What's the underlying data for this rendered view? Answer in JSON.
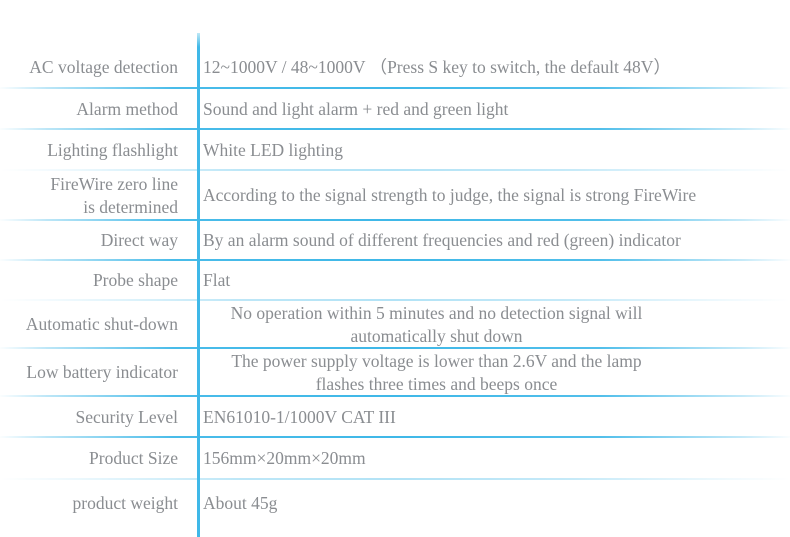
{
  "table": {
    "colors": {
      "rule": "#3fb8e8",
      "text": "#8a8d91",
      "background": "#ffffff"
    },
    "rows": [
      {
        "label": "AC voltage detection",
        "value": "12~1000V / 48~1000V （Press S key to switch, the default 48V）",
        "multiline": false,
        "separator": "strong"
      },
      {
        "label": "Alarm method",
        "value": "Sound and light alarm + red and green light",
        "multiline": false,
        "separator": "strong"
      },
      {
        "label": "Lighting flashlight",
        "value": "White LED lighting",
        "multiline": false,
        "separator": "faint"
      },
      {
        "label": "FireWire zero line\nis determined",
        "value": "According to the signal strength to judge, the signal is strong FireWire",
        "multiline": false,
        "separator": "strong"
      },
      {
        "label": "Direct way",
        "value": "By an alarm sound of different frequencies and red (green) indicator",
        "multiline": false,
        "separator": "strong"
      },
      {
        "label": "Probe shape",
        "value": "Flat",
        "multiline": false,
        "separator": "faint"
      },
      {
        "label": "Automatic shut-down",
        "value": "No operation within 5 minutes and no detection signal will\nautomatically shut down",
        "multiline": true,
        "separator": "strong"
      },
      {
        "label": "Low battery indicator",
        "value": "The power supply voltage is lower than 2.6V and the lamp\nflashes three times and beeps once",
        "multiline": true,
        "separator": "strong"
      },
      {
        "label": "Security Level",
        "value": "EN61010-1/1000V  CAT III",
        "multiline": false,
        "separator": "strong"
      },
      {
        "label": "Product Size",
        "value": "156mm×20mm×20mm",
        "multiline": false,
        "separator": "faint"
      },
      {
        "label": "product weight",
        "value": "About 45g",
        "multiline": false,
        "separator": "none"
      }
    ]
  }
}
